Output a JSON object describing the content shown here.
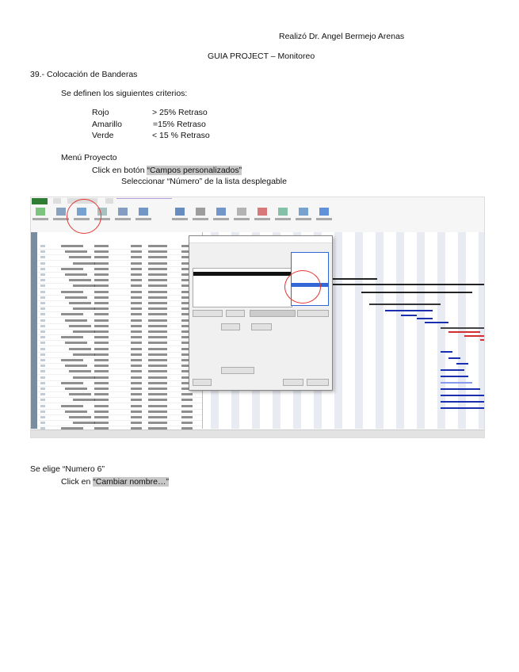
{
  "header": {
    "author": "Realizó Dr. Angel Bermejo Arenas",
    "title": "GUIA PROJECT – Monitoreo"
  },
  "section": {
    "heading": "39.- Colocación de Banderas",
    "intro": "Se definen los siguientes criterios:",
    "criteria": [
      {
        "color": "Rojo",
        "rule": "> 25% Retraso"
      },
      {
        "color": "Amarillo",
        "rule": "=15% Retraso"
      },
      {
        "color": "Verde",
        "rule": "< 15 % Retraso"
      }
    ],
    "menu": "Menú Proyecto",
    "step1_prefix": "Click en botón ",
    "step1_highlight": "“Campos personalizados”",
    "step2": "Seleccionar “Número” de la lista desplegable",
    "step3": "Se elige “Numero 6”",
    "step4_prefix": "Click en ",
    "step4_highlight": "“Cambiar nombre…”"
  },
  "colors": {
    "highlight": "#c8c8c8",
    "annotation_circle": "#e53935",
    "selection": "#3367d6",
    "file_tab": "#2e7d32"
  }
}
